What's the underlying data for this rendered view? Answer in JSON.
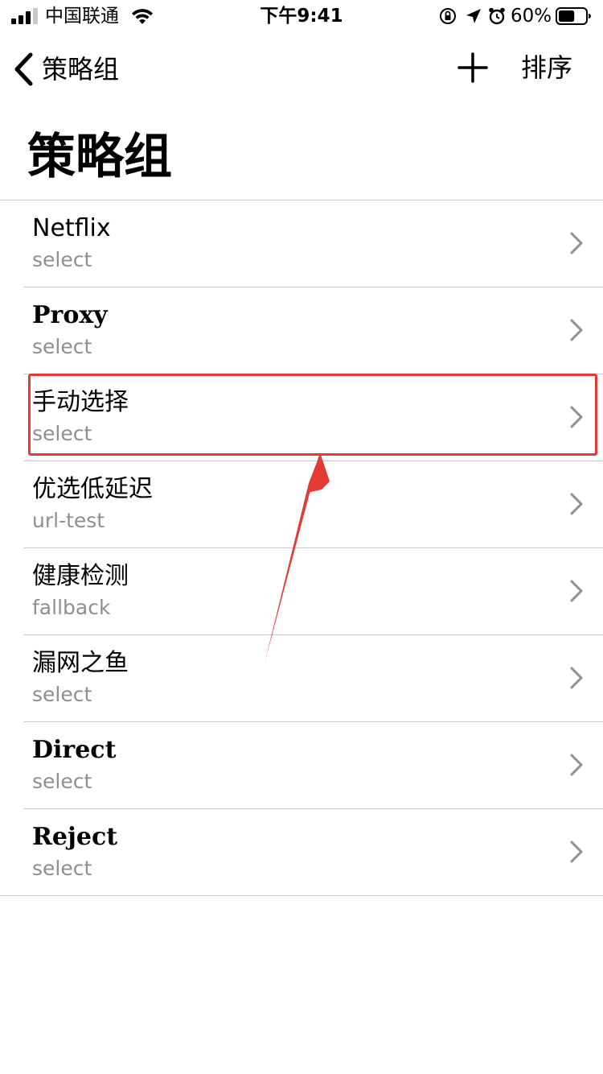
{
  "status_bar": {
    "carrier": "中国联通",
    "time": "下午9:41",
    "battery": "60%",
    "battery_level": 0.6,
    "icons": [
      "signal-icon",
      "wifi-icon",
      "orientation-lock-icon",
      "location-icon",
      "alarm-icon",
      "battery-icon"
    ]
  },
  "nav": {
    "back_label": "策略组",
    "add_icon": "plus-icon",
    "sort_label": "排序"
  },
  "title": "策略组",
  "groups": [
    {
      "name": "Netflix",
      "type": "select"
    },
    {
      "name": "Proxy",
      "type": "select"
    },
    {
      "name": "手动选择",
      "type": "select"
    },
    {
      "name": "优选低延迟",
      "type": "url-test"
    },
    {
      "name": "健康检测",
      "type": "fallback"
    },
    {
      "name": "漏网之鱼",
      "type": "select"
    },
    {
      "name": "Direct",
      "type": "select"
    },
    {
      "name": "Reject",
      "type": "select"
    }
  ],
  "colors": {
    "annotation": "#e53935",
    "secondary_text": "#8e8e93",
    "separator": "#c8c7cc",
    "chevron": "#8e8e93"
  }
}
